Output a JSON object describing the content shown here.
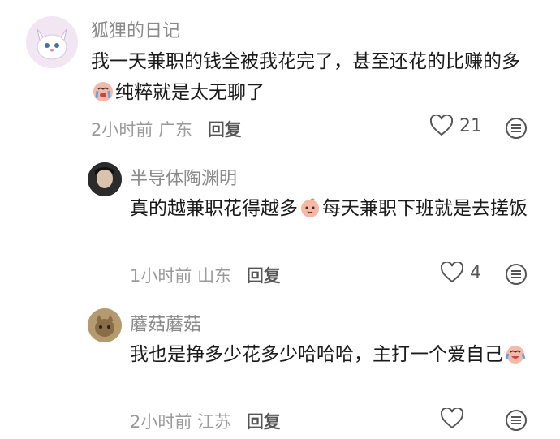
{
  "comments": [
    {
      "name": "狐狸的日记",
      "text_a": "我一天兼职的钱全被我花完了，甚至还花的比赚的多",
      "text_b": "纯粹就是太无聊了",
      "time": "2小时前",
      "location": "广东",
      "reply": "回复",
      "likes": "21",
      "emoji": "crying-face-icon"
    },
    {
      "name": "半导体陶渊明",
      "text_a": "真的越兼职花得越多",
      "text_b": "每天兼职下班就是去搓饭",
      "time": "1小时前",
      "location": "山东",
      "reply": "回复",
      "likes": "4",
      "emoji": "peach-face-icon"
    },
    {
      "name": "蘑菇蘑菇",
      "text_a": "我也是挣多少花多少哈哈哈，主打一个爱自己",
      "time": "2小时前",
      "location": "江苏",
      "reply": "回复",
      "likes": "",
      "emoji": "laughing-cry-face-icon"
    }
  ]
}
